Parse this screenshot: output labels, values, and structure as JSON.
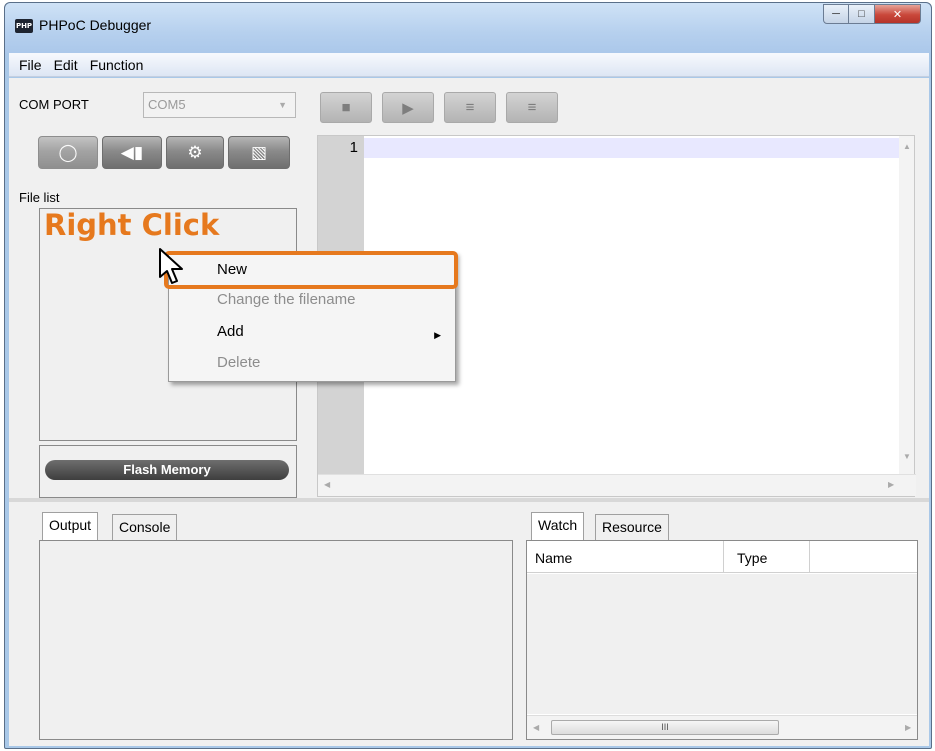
{
  "window": {
    "title": "PHPoC Debugger",
    "icon_text": "PHP"
  },
  "menubar": {
    "items": [
      "File",
      "Edit",
      "Function"
    ]
  },
  "left_panel": {
    "com_port_label": "COM PORT",
    "com_port_value": "COM5",
    "file_list_label": "File list",
    "flash_memory_label": "Flash Memory",
    "annotation": "Right Click"
  },
  "editor": {
    "line_numbers": [
      "1"
    ]
  },
  "context_menu": {
    "items": [
      {
        "label": "New",
        "enabled": true
      },
      {
        "label": "Change the filename",
        "enabled": false
      },
      {
        "label": "Add",
        "enabled": true
      },
      {
        "label": "Delete",
        "enabled": false
      }
    ]
  },
  "output_panel": {
    "tabs": [
      "Output",
      "Console"
    ]
  },
  "watch_panel": {
    "tabs": [
      "Watch",
      "Resource"
    ],
    "columns": [
      "Name",
      "Type"
    ],
    "hscroll_thumb": "III"
  },
  "colors": {
    "accent": "#e6791e",
    "titlebar": "#b6d0ee"
  }
}
